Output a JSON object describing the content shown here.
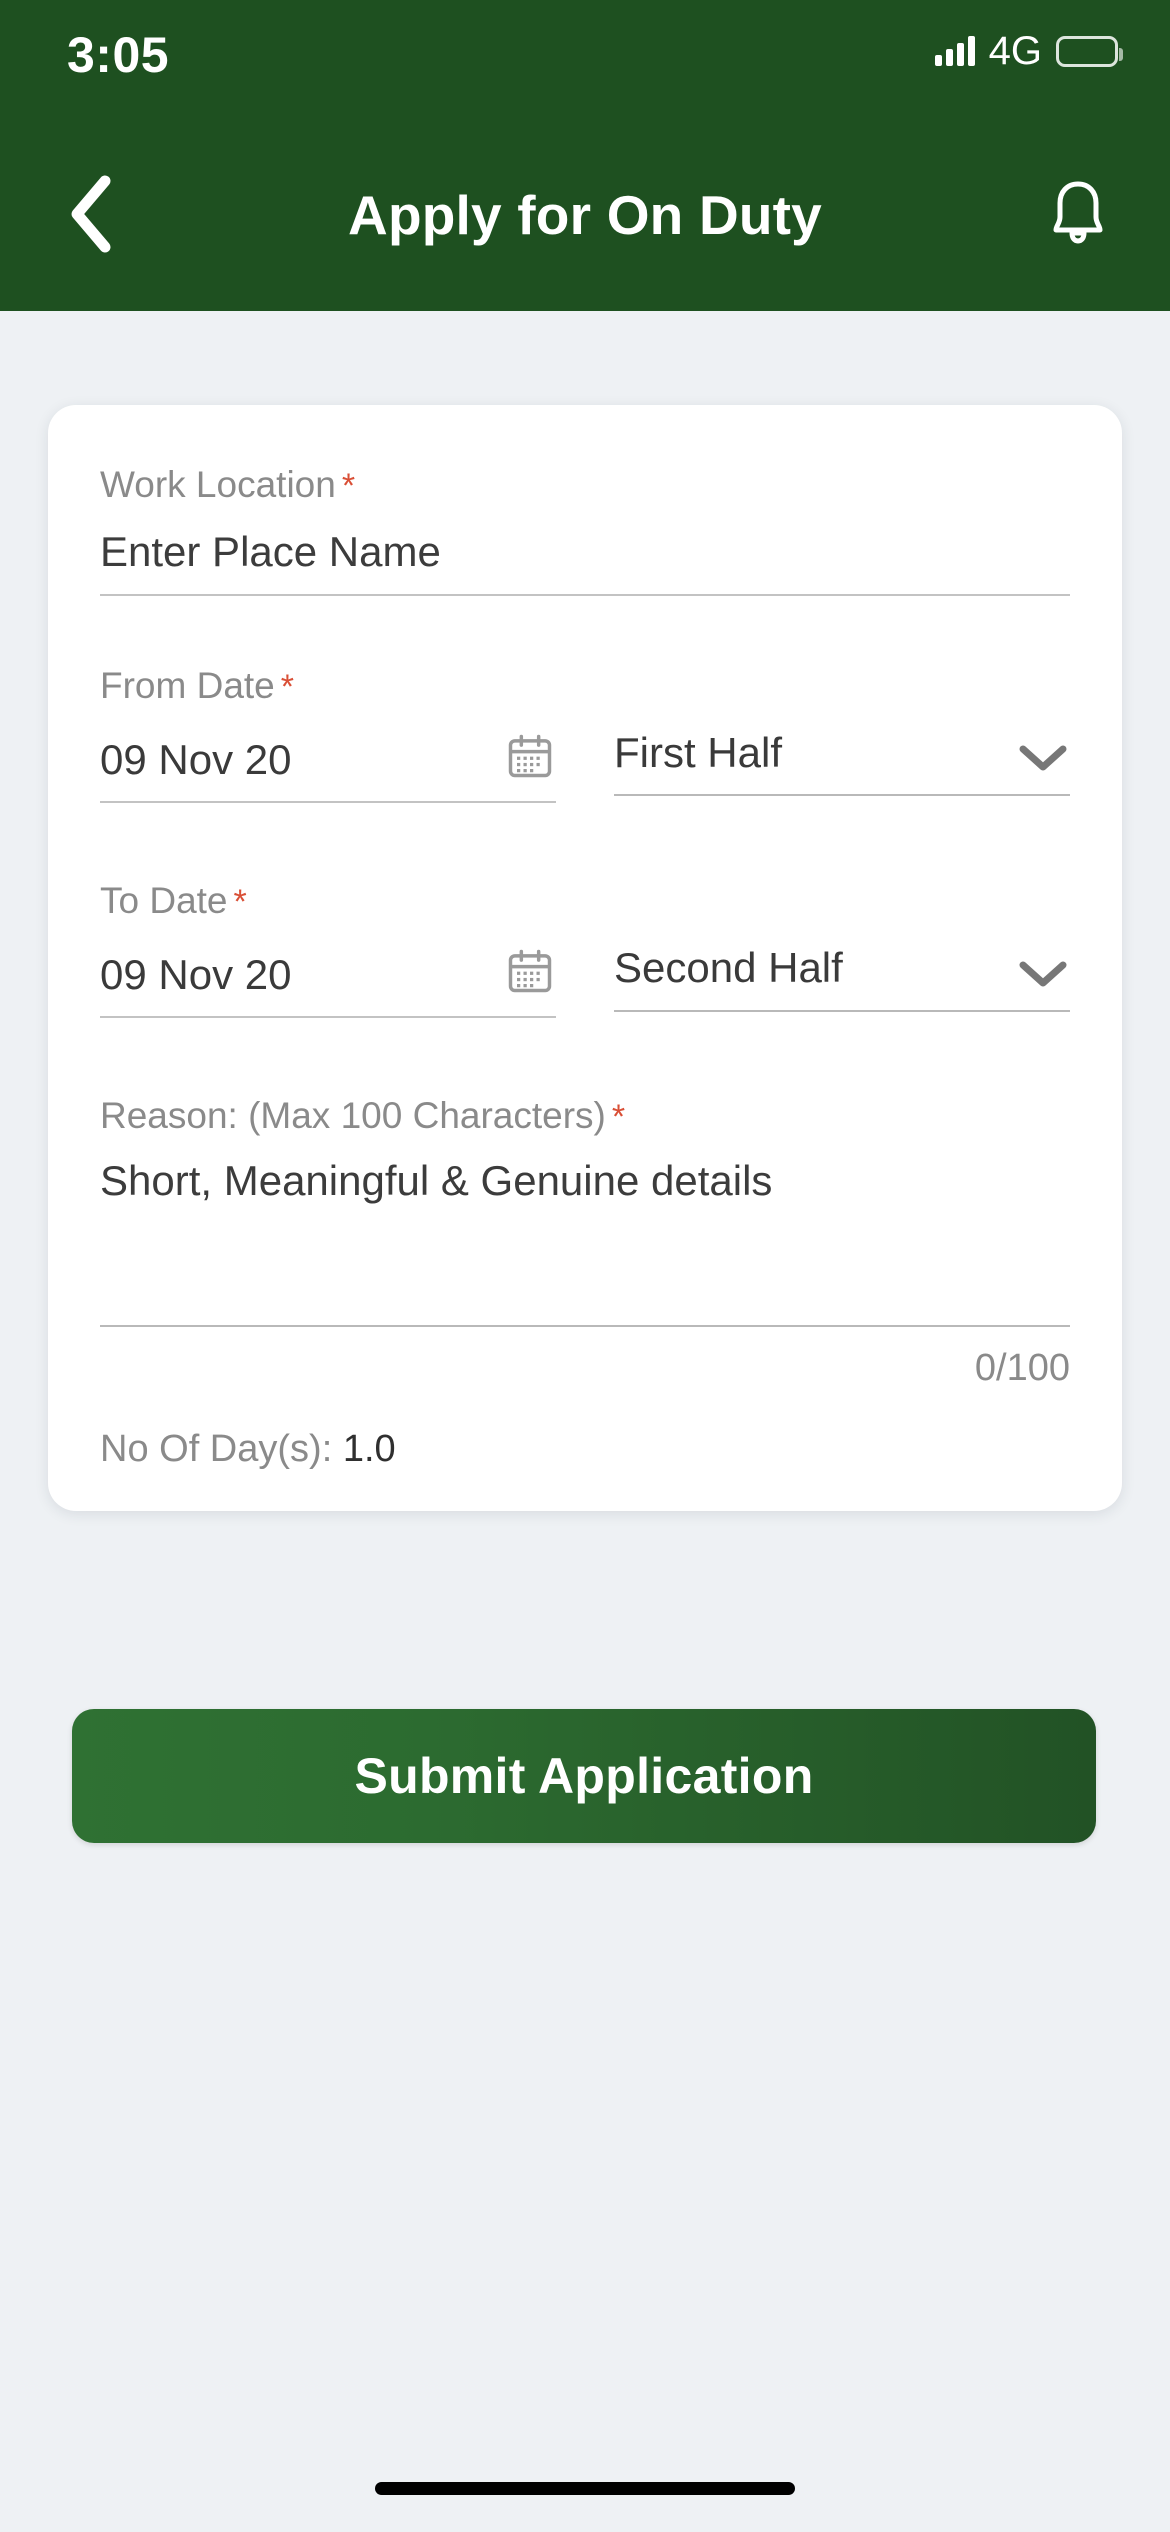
{
  "status_bar": {
    "time": "3:05",
    "network": "4G",
    "signal_icon": "signal-bars-icon",
    "battery_icon": "battery-icon"
  },
  "header": {
    "title": "Apply for On Duty",
    "back_icon": "chevron-left-icon",
    "notification_icon": "bell-icon",
    "background_color": "#1e5020"
  },
  "form": {
    "work_location": {
      "label": "Work Location",
      "required_marker": "*",
      "placeholder": "Enter Place Name",
      "value": ""
    },
    "from_date": {
      "label": "From Date",
      "required_marker": "*",
      "value": "09 Nov 20",
      "calendar_icon": "calendar-icon",
      "half_value": "First Half",
      "chevron_icon": "chevron-down-icon"
    },
    "to_date": {
      "label": "To Date",
      "required_marker": "*",
      "value": "09 Nov 20",
      "calendar_icon": "calendar-icon",
      "half_value": "Second Half",
      "chevron_icon": "chevron-down-icon"
    },
    "reason": {
      "label": "Reason: (Max 100 Characters)",
      "required_marker": "*",
      "placeholder": "Short, Meaningful & Genuine details",
      "value": "",
      "counter": "0/100"
    },
    "no_of_days": {
      "label": "No Of Day(s): ",
      "value": "1.0"
    }
  },
  "submit": {
    "label": "Submit Application",
    "color_start": "#2f7133",
    "color_end": "#225225"
  },
  "colors": {
    "accent_green": "#1e5020",
    "required_red": "#d94f36",
    "page_background": "#eef1f4",
    "label_gray": "#8a8a8a"
  }
}
